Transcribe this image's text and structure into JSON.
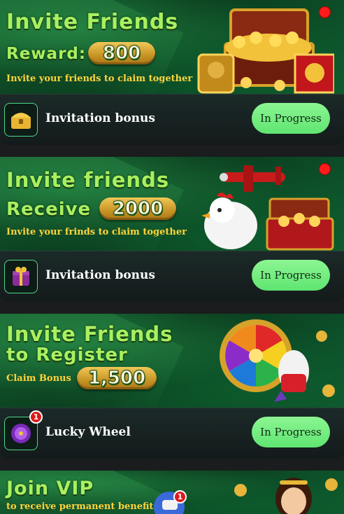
{
  "cards": [
    {
      "banner": {
        "title": "Invite Friends",
        "reward_label": "Reward:",
        "reward_value": "800",
        "subtitle": "Invite your friends to claim together"
      },
      "footer": {
        "icon": "treasure-chest-icon",
        "label": "Invitation bonus",
        "button": "In Progress"
      }
    },
    {
      "banner": {
        "title": "Invite friends",
        "reward_label": "Receive",
        "reward_value": "2000",
        "subtitle": "Invite your frinds to claim together"
      },
      "footer": {
        "icon": "gift-box-icon",
        "label": "Invitation bonus",
        "button": "In Progress"
      }
    },
    {
      "banner": {
        "title_line1": "Invite Friends",
        "title_line2": "to Register",
        "claim_label": "Claim Bonus",
        "reward_value": "1,500"
      },
      "footer": {
        "icon": "lucky-wheel-icon",
        "label": "Lucky Wheel",
        "button": "In Progress",
        "badge": "1"
      }
    },
    {
      "banner": {
        "title": "Join VIP",
        "subtitle": "to receive permanent benefits",
        "badge": "1"
      }
    }
  ],
  "colors": {
    "banner_green": "#0f4f28",
    "title_green": "#a8f060",
    "subtitle_yellow": "#ffd43b",
    "button_green": "#6cec7a",
    "badge_red": "#e01818"
  }
}
